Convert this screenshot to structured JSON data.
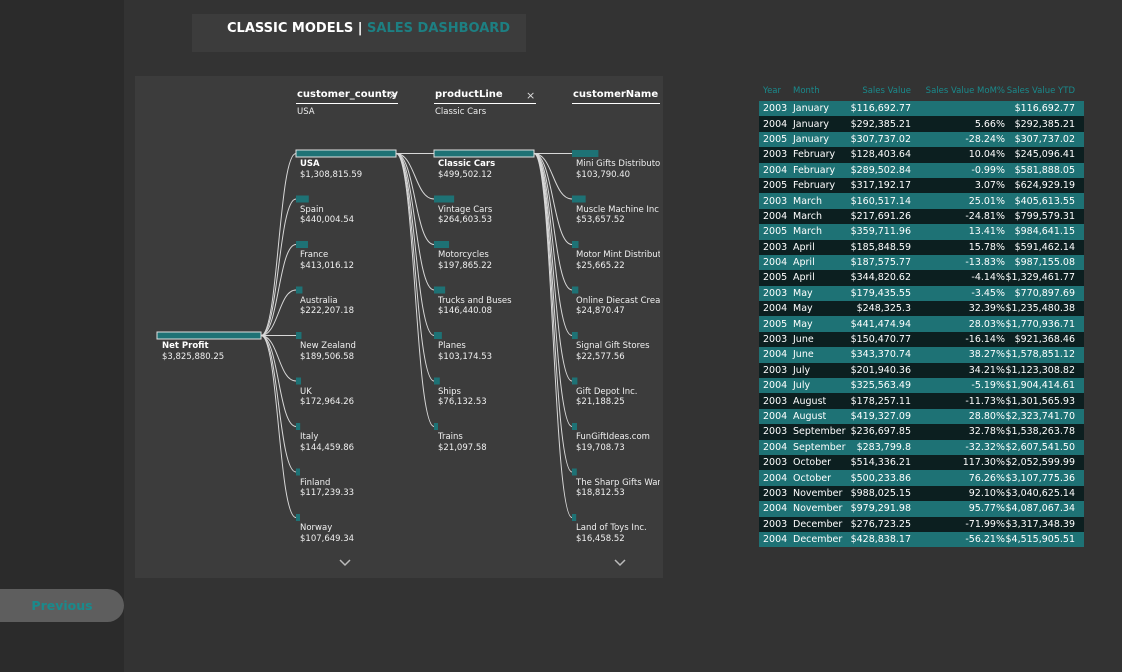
{
  "title": {
    "main": "CLASSIC MODELS |",
    "sub": "SALES DASHBOARD"
  },
  "nav": {
    "previous_label": "Previous"
  },
  "tree": {
    "root": {
      "name": "Net Profit",
      "value": "$3,825,880.25"
    },
    "levels": [
      {
        "header": "customer_country",
        "selected": "USA",
        "close": "×"
      },
      {
        "header": "productLine",
        "selected": "Classic Cars",
        "close": "×"
      },
      {
        "header": "customerName",
        "selected": "",
        "close": ""
      }
    ],
    "countries": [
      {
        "name": "USA",
        "value": "$1,308,815.59"
      },
      {
        "name": "Spain",
        "value": "$440,004.54"
      },
      {
        "name": "France",
        "value": "$413,016.12"
      },
      {
        "name": "Australia",
        "value": "$222,207.18"
      },
      {
        "name": "New Zealand",
        "value": "$189,506.58"
      },
      {
        "name": "UK",
        "value": "$172,964.26"
      },
      {
        "name": "Italy",
        "value": "$144,459.86"
      },
      {
        "name": "Finland",
        "value": "$117,239.33"
      },
      {
        "name": "Norway",
        "value": "$107,649.34"
      }
    ],
    "product_lines": [
      {
        "name": "Classic Cars",
        "value": "$499,502.12"
      },
      {
        "name": "Vintage Cars",
        "value": "$264,603.53"
      },
      {
        "name": "Motorcycles",
        "value": "$197,865.22"
      },
      {
        "name": "Trucks and Buses",
        "value": "$146,440.08"
      },
      {
        "name": "Planes",
        "value": "$103,174.53"
      },
      {
        "name": "Ships",
        "value": "$76,132.53"
      },
      {
        "name": "Trains",
        "value": "$21,097.58"
      }
    ],
    "customers": [
      {
        "name": "Mini Gifts Distributo",
        "value": "$103,790.40"
      },
      {
        "name": "Muscle Machine Inc",
        "value": "$53,657.52"
      },
      {
        "name": "Motor Mint Distribut",
        "value": "$25,665.22"
      },
      {
        "name": "Online Diecast Creat",
        "value": "$24,870.47"
      },
      {
        "name": "Signal Gift Stores",
        "value": "$22,577.56"
      },
      {
        "name": "Gift Depot Inc.",
        "value": "$21,188.25"
      },
      {
        "name": "FunGiftIdeas.com",
        "value": "$19,708.73"
      },
      {
        "name": "The Sharp Gifts Ware",
        "value": "$18,812.53"
      },
      {
        "name": "Land of Toys Inc.",
        "value": "$16,458.52"
      }
    ]
  },
  "table": {
    "headers": [
      "Year",
      "Month",
      "Sales Value",
      "Sales Value MoM%",
      "Sales Value YTD"
    ],
    "rows": [
      [
        "2003",
        "January",
        "$116,692.77",
        "",
        "$116,692.77"
      ],
      [
        "2004",
        "January",
        "$292,385.21",
        "5.66%",
        "$292,385.21"
      ],
      [
        "2005",
        "January",
        "$307,737.02",
        "-28.24%",
        "$307,737.02"
      ],
      [
        "2003",
        "February",
        "$128,403.64",
        "10.04%",
        "$245,096.41"
      ],
      [
        "2004",
        "February",
        "$289,502.84",
        "-0.99%",
        "$581,888.05"
      ],
      [
        "2005",
        "February",
        "$317,192.17",
        "3.07%",
        "$624,929.19"
      ],
      [
        "2003",
        "March",
        "$160,517.14",
        "25.01%",
        "$405,613.55"
      ],
      [
        "2004",
        "March",
        "$217,691.26",
        "-24.81%",
        "$799,579.31"
      ],
      [
        "2005",
        "March",
        "$359,711.96",
        "13.41%",
        "$984,641.15"
      ],
      [
        "2003",
        "April",
        "$185,848.59",
        "15.78%",
        "$591,462.14"
      ],
      [
        "2004",
        "April",
        "$187,575.77",
        "-13.83%",
        "$987,155.08"
      ],
      [
        "2005",
        "April",
        "$344,820.62",
        "-4.14%",
        "$1,329,461.77"
      ],
      [
        "2003",
        "May",
        "$179,435.55",
        "-3.45%",
        "$770,897.69"
      ],
      [
        "2004",
        "May",
        "$248,325.3",
        "32.39%",
        "$1,235,480.38"
      ],
      [
        "2005",
        "May",
        "$441,474.94",
        "28.03%",
        "$1,770,936.71"
      ],
      [
        "2003",
        "June",
        "$150,470.77",
        "-16.14%",
        "$921,368.46"
      ],
      [
        "2004",
        "June",
        "$343,370.74",
        "38.27%",
        "$1,578,851.12"
      ],
      [
        "2003",
        "July",
        "$201,940.36",
        "34.21%",
        "$1,123,308.82"
      ],
      [
        "2004",
        "July",
        "$325,563.49",
        "-5.19%",
        "$1,904,414.61"
      ],
      [
        "2003",
        "August",
        "$178,257.11",
        "-11.73%",
        "$1,301,565.93"
      ],
      [
        "2004",
        "August",
        "$419,327.09",
        "28.80%",
        "$2,323,741.70"
      ],
      [
        "2003",
        "September",
        "$236,697.85",
        "32.78%",
        "$1,538,263.78"
      ],
      [
        "2004",
        "September",
        "$283,799.8",
        "-32.32%",
        "$2,607,541.50"
      ],
      [
        "2003",
        "October",
        "$514,336.21",
        "117.30%",
        "$2,052,599.99"
      ],
      [
        "2004",
        "October",
        "$500,233.86",
        "76.26%",
        "$3,107,775.36"
      ],
      [
        "2003",
        "November",
        "$988,025.15",
        "92.10%",
        "$3,040,625.14"
      ],
      [
        "2004",
        "November",
        "$979,291.98",
        "95.77%",
        "$4,087,067.34"
      ],
      [
        "2003",
        "December",
        "$276,723.25",
        "-71.99%",
        "$3,317,348.39"
      ],
      [
        "2004",
        "December",
        "$428,838.17",
        "-56.21%",
        "$4,515,905.51"
      ]
    ]
  },
  "colors": {
    "accent": "#1d7f82",
    "row_teal": "#1e7275",
    "row_dark": "#0c1f20",
    "background": "#333333",
    "panel": "#3c3c3c"
  }
}
